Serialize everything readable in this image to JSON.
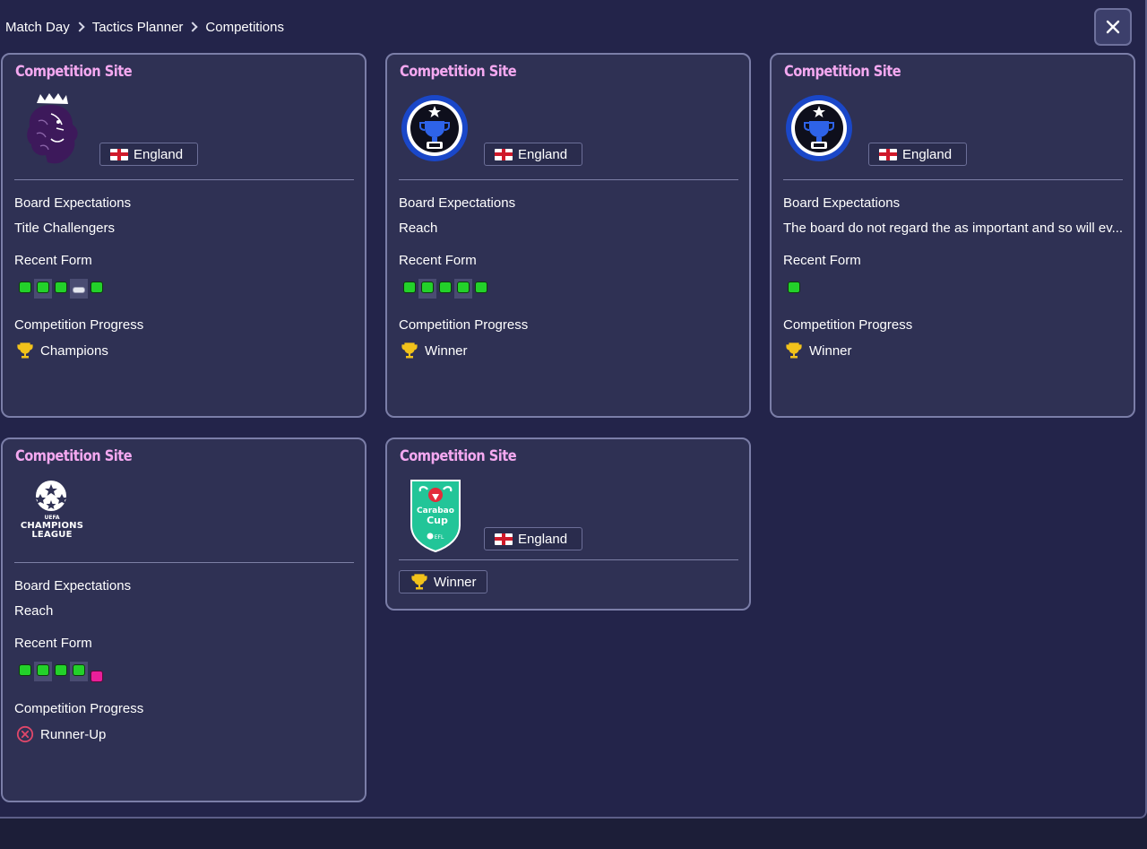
{
  "breadcrumb": [
    "Match Day",
    "Tactics Planner",
    "Competitions"
  ],
  "cards": [
    {
      "title": "Competition Site",
      "logo": "premier-league-lion-logo",
      "nation": "England",
      "board_label": "Board Expectations",
      "board_value": "Title Challengers",
      "form_label": "Recent Form",
      "form": [
        "W",
        "W",
        "W",
        "D",
        "W"
      ],
      "progress_label": "Competition Progress",
      "progress_icon": "trophy-icon",
      "progress_value": "Champions"
    },
    {
      "title": "Competition Site",
      "logo": "cup-trophy-badge-logo",
      "nation": "England",
      "board_label": "Board Expectations",
      "board_value": "Reach",
      "form_label": "Recent Form",
      "form": [
        "W",
        "W",
        "W",
        "W",
        "W"
      ],
      "progress_label": "Competition Progress",
      "progress_icon": "trophy-icon",
      "progress_value": "Winner"
    },
    {
      "title": "Competition Site",
      "logo": "cup-trophy-badge-logo",
      "nation": "England",
      "board_label": "Board Expectations",
      "board_value": "The board do not regard the as important and so will ev...",
      "form_label": "Recent Form",
      "form": [
        "W"
      ],
      "progress_label": "Competition Progress",
      "progress_icon": "trophy-icon",
      "progress_value": "Winner"
    },
    {
      "title": "Competition Site",
      "logo": "champions-league-logo",
      "logo_text": [
        "UEFA",
        "CHAMPIONS",
        "LEAGUE"
      ],
      "board_label": "Board Expectations",
      "board_value": "Reach",
      "form_label": "Recent Form",
      "form": [
        "W",
        "W",
        "W",
        "W",
        "L"
      ],
      "progress_label": "Competition Progress",
      "progress_icon": "runner-up-icon",
      "progress_value": "Runner-Up"
    },
    {
      "title": "Competition Site",
      "logo": "carabao-cup-logo",
      "logo_text": [
        "Carabao",
        "Cup",
        "EFL"
      ],
      "nation": "England",
      "progress_icon": "trophy-icon",
      "progress_value": "Winner"
    }
  ],
  "colors": {
    "background": "#23244a",
    "card": "#2f3154",
    "card_border": "#7b7ea8",
    "title": "#f4a8f0",
    "form_win": "#23d12a",
    "form_draw": "#e4e6ee",
    "form_loss": "#ea1f9a",
    "trophy": "#f2c21b",
    "runner_up": "#e0476a"
  }
}
